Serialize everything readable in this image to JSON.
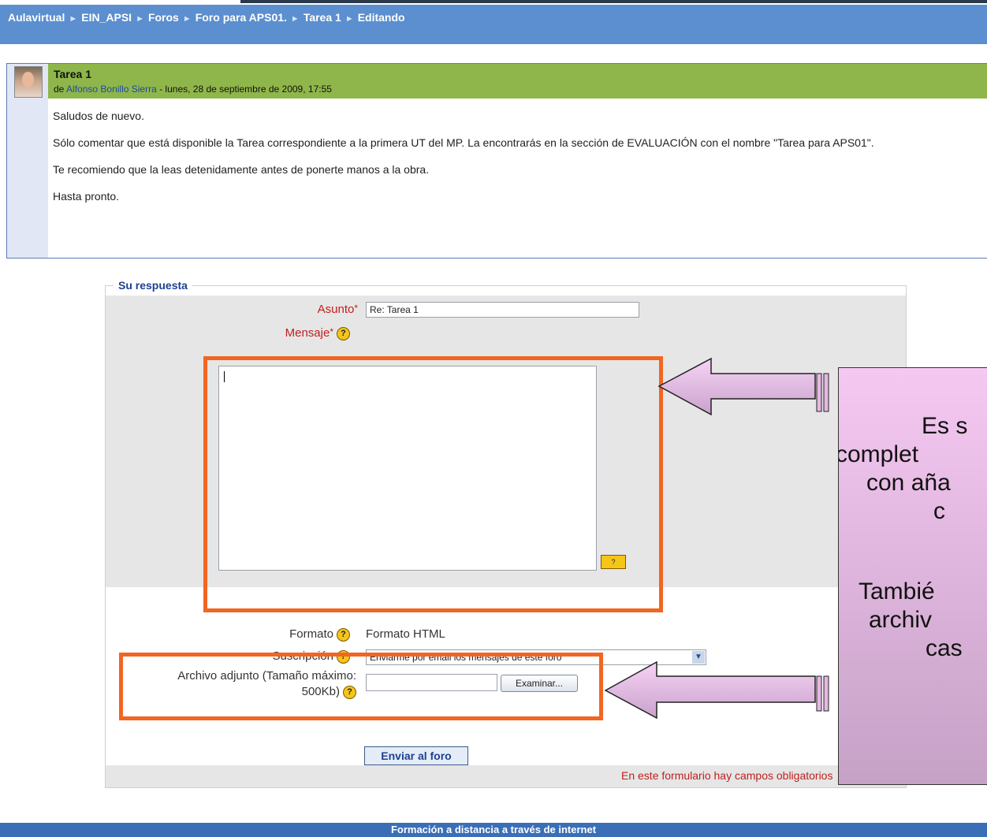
{
  "breadcrumbs": [
    "Aulavirtual",
    "EIN_APSI",
    "Foros",
    "Foro para APS01.",
    "Tarea 1",
    "Editando"
  ],
  "breadcrumb_separator": "►",
  "post": {
    "title": "Tarea 1",
    "by_prefix": "de ",
    "author": "Alfonso Bonillo Sierra",
    "date": " - lunes, 28 de septiembre de 2009, 17:55",
    "paragraphs": [
      "Saludos de nuevo.",
      "Sólo comentar que está disponible la Tarea correspondiente a la primera UT del MP. La encontrarás en la sección de EVALUACIÓN con el nombre \"Tarea para APS01\".",
      "Te recomiendo que la leas detenidamente antes de ponerte manos a la obra.",
      "Hasta pronto."
    ]
  },
  "form": {
    "legend": "Su respuesta",
    "subject_label": "Asunto",
    "subject_value": "Re: Tarea 1",
    "message_label": "Mensaje",
    "help_glyph": "?",
    "keyboard_glyph": "?",
    "format_label": "Formato",
    "format_value": "Formato HTML",
    "subscription_label": "Suscripción",
    "subscription_value": "Enviarme por email los mensajes de este foro",
    "attachment_label_1": "Archivo adjunto (Tamaño máximo:",
    "attachment_label_2": "500Kb)",
    "browse_button": "Examinar...",
    "submit_button": "Enviar al foro",
    "required_note": "En este formulario hay campos obligatorios"
  },
  "callout": {
    "lines": [
      "Es s",
      "complet",
      "con aña",
      "c",
      "",
      "Tambié",
      "archiv",
      "cas"
    ]
  },
  "footer": "Formación a distancia a través de internet",
  "colors": {
    "navbar": "#5b8fcf",
    "post_header": "#8fb64a",
    "highlight": "#f26522",
    "callout_top": "#f5c8f2",
    "callout_bottom": "#c6a1c6",
    "footer": "#3a6fb7"
  }
}
